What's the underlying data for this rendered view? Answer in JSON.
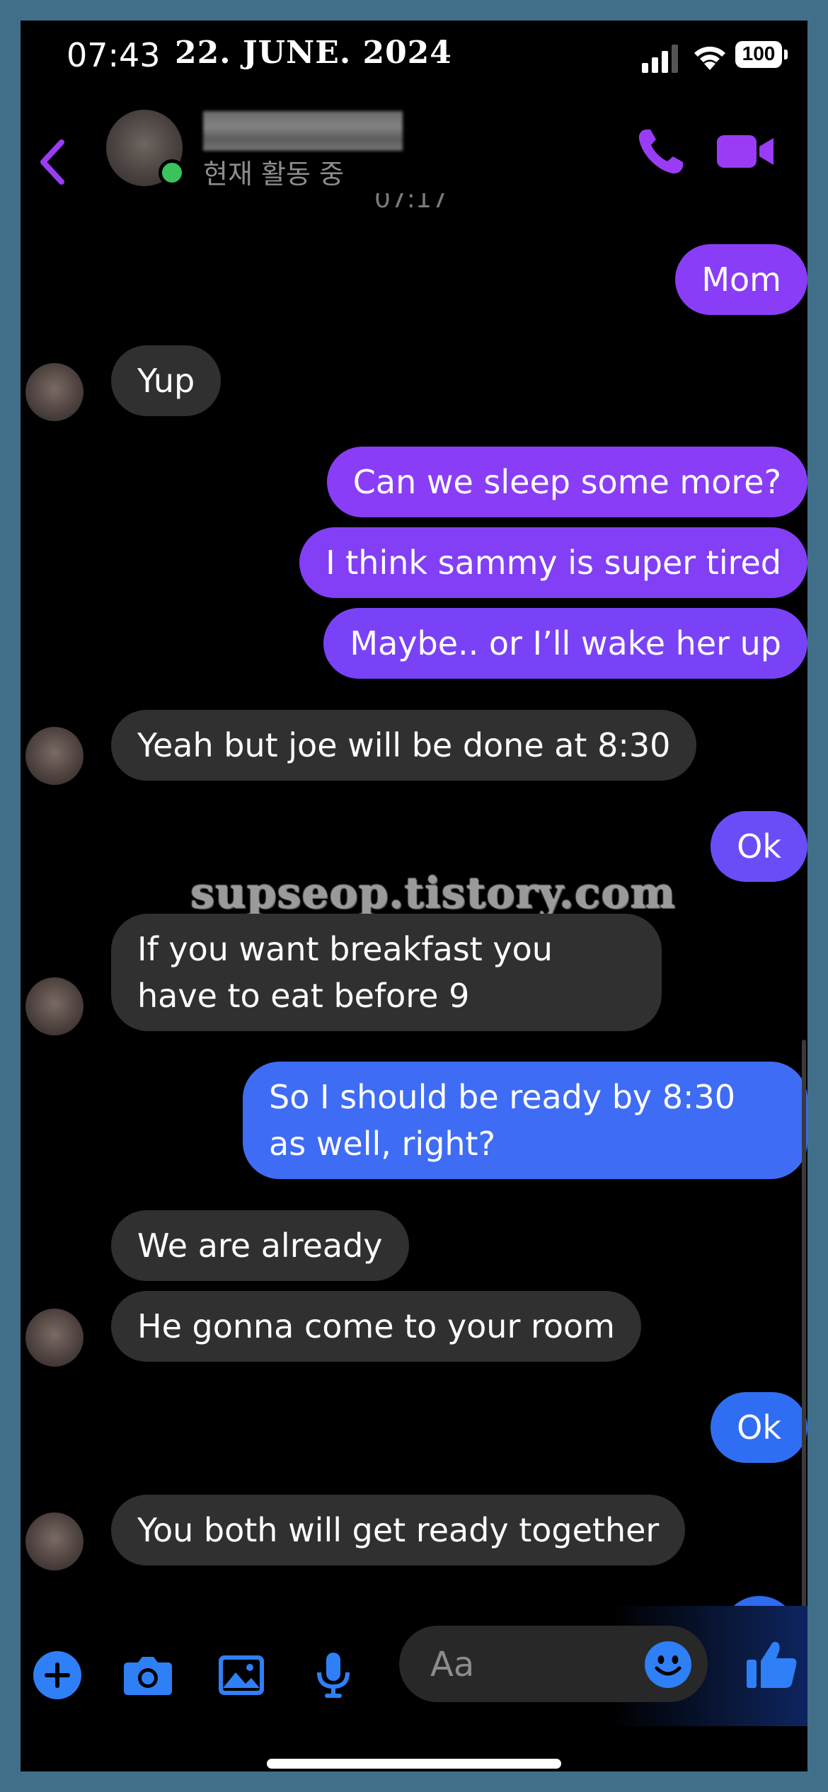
{
  "status_bar": {
    "time": "07:43",
    "date": "22. JUNE. 2024",
    "battery": "100"
  },
  "header": {
    "active_status": "현재 활동 중",
    "partial_timestamp": "07:17"
  },
  "colors": {
    "accent_purple": "#9a3cf5",
    "bubble_purple": "#8a3df6",
    "bubble_violet": "#6a4df7",
    "bubble_blue": "#3f6cf4",
    "bubble_blue_bottom": "#2d6bf0",
    "received_bubble": "#303030",
    "toolbar_blue": "#2f7ff7"
  },
  "messages": [
    {
      "side": "sent",
      "text": "Mom"
    },
    {
      "side": "received",
      "text": "Yup"
    },
    {
      "side": "sent",
      "text": "Can we sleep some more?"
    },
    {
      "side": "sent",
      "text": "I think sammy is super tired"
    },
    {
      "side": "sent",
      "text": "Maybe.. or I’ll wake her up"
    },
    {
      "side": "received",
      "text": "Yeah but joe will be done at 8:30"
    },
    {
      "side": "sent",
      "text": "Ok"
    },
    {
      "side": "received",
      "text": "If you want breakfast you have to eat before 9"
    },
    {
      "side": "sent",
      "text": "So I should be ready by 8:30 as well, right?"
    },
    {
      "side": "received",
      "text": "We are already"
    },
    {
      "side": "received",
      "text": "He gonna come to your room"
    },
    {
      "side": "sent",
      "text": "Ok"
    },
    {
      "side": "received",
      "text": "You both will get ready together"
    }
  ],
  "watermark": "supseop.tistory.com",
  "composer": {
    "placeholder": "Aa"
  },
  "icons": {
    "back": "chevron-left-icon",
    "call": "phone-icon",
    "video": "video-camera-icon",
    "plus": "plus-circle-icon",
    "camera": "camera-icon",
    "gallery": "image-icon",
    "mic": "microphone-icon",
    "emoji": "smiley-icon",
    "like": "thumbs-up-icon"
  }
}
